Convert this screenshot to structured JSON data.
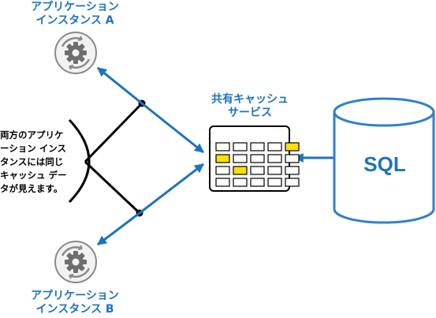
{
  "app_a": {
    "line1": "アプリケーション",
    "line2": "インスタンス A",
    "icon": "gear-sync-icon"
  },
  "app_b": {
    "line1": "アプリケーション",
    "line2": "インスタンス B",
    "icon": "gear-sync-icon"
  },
  "cache": {
    "line1": "共有キャッシュ",
    "line2": "サービス",
    "icon": "cache-grid-icon"
  },
  "database": {
    "label": "SQL",
    "icon": "database-cylinder-icon"
  },
  "note": {
    "line1": "両方のアプリケ",
    "line2": "ーション インス",
    "line3": "タンスには同じ",
    "line4": "キャッシュ デー",
    "line5": "タが見えます。"
  },
  "colors": {
    "accent": "#1e73be",
    "highlight": "#ffe000",
    "icon_gray": "#8a8a8a"
  }
}
